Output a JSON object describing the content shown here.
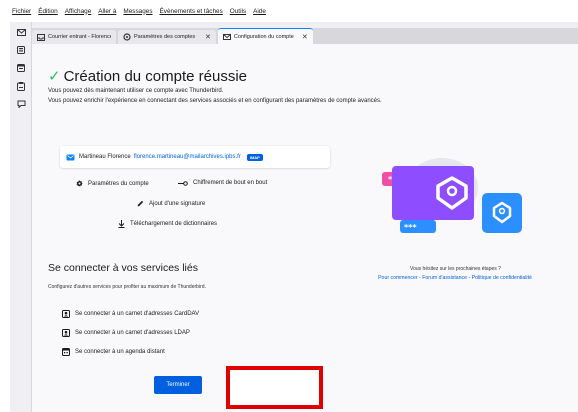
{
  "menubar": {
    "items": [
      "Fichier",
      "Édition",
      "Affichage",
      "Aller à",
      "Messages",
      "Évènements et tâches",
      "Outils",
      "Aide"
    ]
  },
  "tabs": [
    {
      "label": "Courrier entrant - Florence Mar…",
      "icon": "inbox-icon",
      "closable": false,
      "active": false
    },
    {
      "label": "Paramètres des comptes Co…",
      "icon": "gear-icon",
      "closable": true,
      "active": false
    },
    {
      "label": "Configuration du compte",
      "icon": "mail-icon",
      "closable": true,
      "active": true
    }
  ],
  "spaces": [
    "mail-icon",
    "address-book-icon",
    "calendar-icon",
    "tasks-icon",
    "chat-icon"
  ],
  "main": {
    "title": "Création du compte réussie",
    "line1": "Vous pouvez dès maintenant utiliser ce compte avec Thunderbird.",
    "line2": "Vous pouvez enrichir l'expérience en connectant des services associés et en configurant des paramètres de compte avancés."
  },
  "account": {
    "name": "Martineau Florence",
    "email": "florence.martineau@mailarchives.ipbs.fr",
    "badge": "IMAP"
  },
  "settings_links": {
    "account_settings": "Paramètres du compte",
    "e2e": "Chiffrement de bout en bout",
    "signature": "Ajout d'une signature",
    "dictionaries": "Téléchargement de dictionnaires"
  },
  "services": {
    "title": "Se connecter à vos services liés",
    "subtitle": "Configurez d'autres services pour profiter au maximum de Thunderbird.",
    "carddav": "Se connecter à un carnet d'adresses CardDAV",
    "ldap": "Se connecter à un carnet d'adresses LDAP",
    "calendar": "Se connecter à un agenda distant"
  },
  "help": {
    "text": "Vous hésitez sur les prochaines étapes ?",
    "links": "Pour commencer - Forum d'assistance - Politique de confidentialité"
  },
  "finish_button": "Terminer",
  "colors": {
    "accent": "#0060df",
    "success": "#2ac35b",
    "annotation": "#e00000",
    "illustration_purple": "#8e4dff",
    "illustration_pink": "#ef4fa6",
    "illustration_blue": "#2c8fff"
  }
}
